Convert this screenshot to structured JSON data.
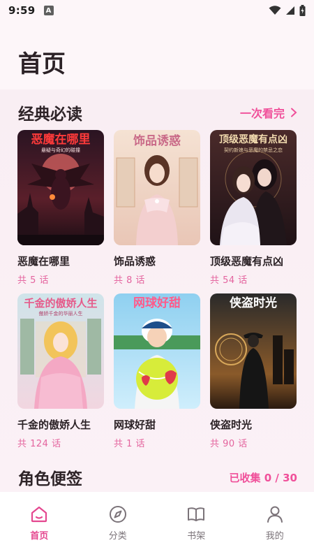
{
  "status_bar": {
    "time": "9:59",
    "notif_letter": "A"
  },
  "page_title": "首页",
  "classics": {
    "title": "经典必读",
    "action": "一次看完",
    "books": [
      {
        "title": "恶魔在哪里",
        "count": "共 5 话",
        "cover_title": "恶魔在哪里",
        "cover_sub": "悬疑与奇幻的碰撞"
      },
      {
        "title": "饰品诱惑",
        "count": "共 8 话",
        "cover_title": "饰品诱惑",
        "cover_sub": ""
      },
      {
        "title": "顶级恶魔有点凶",
        "count": "共 54 话",
        "cover_title": "顶级恶魔有点凶",
        "cover_sub": "契约新娘与恶魔的禁忌之恋"
      },
      {
        "title": "千金的傲娇人生",
        "count": "共 124 话",
        "cover_title": "千金的傲娇人生",
        "cover_sub": "傲娇千金的华丽人生"
      },
      {
        "title": "网球好甜",
        "count": "共 1 话",
        "cover_title": "网球好甜",
        "cover_sub": ""
      },
      {
        "title": "侠盗时光",
        "count": "共 90 话",
        "cover_title": "侠盗时光",
        "cover_sub": ""
      }
    ]
  },
  "notes": {
    "title": "角色便签",
    "collected": "已收集 0 / 30"
  },
  "nav": {
    "items": [
      {
        "label": "首页",
        "icon": "home-icon"
      },
      {
        "label": "分类",
        "icon": "compass-icon"
      },
      {
        "label": "书架",
        "icon": "book-icon"
      },
      {
        "label": "我的",
        "icon": "person-icon"
      }
    ],
    "active_color": "#e4478f"
  },
  "colors": {
    "accent": "#f0509a",
    "background": "#fbf3f7"
  }
}
